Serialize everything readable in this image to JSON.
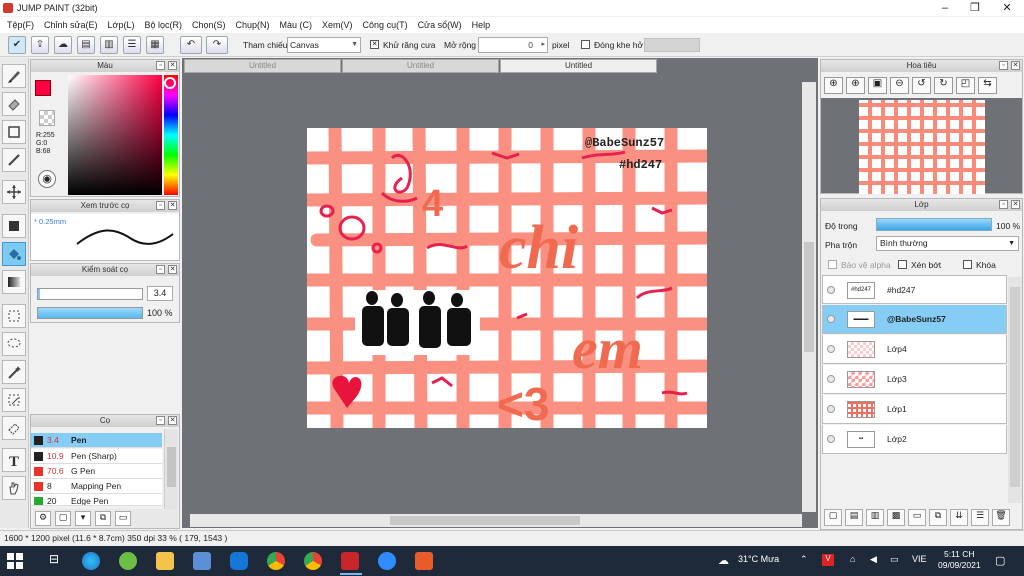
{
  "window": {
    "title": "JUMP PAINT (32bit)"
  },
  "menu": [
    "Tệp(F)",
    "Chỉnh sửa(E)",
    "Lớp(L)",
    "Bộ lọc(R)",
    "Chọn(S)",
    "Chụp(N)",
    "Màu (C)",
    "Xem(V)",
    "Công cụ(T)",
    "Cửa sổ(W)",
    "Help"
  ],
  "toolbar": {
    "ref_label": "Tham chiếu",
    "ref_value": "Canvas",
    "antialias_label": "Khử răng cưa",
    "expand_label": "Mở rộng",
    "expand_value": "0",
    "expand_unit": "pixel",
    "close_gap_label": "Đóng khe hở"
  },
  "doc_tabs": [
    "Untitled",
    "Untitled",
    "Untitled"
  ],
  "color_panel": {
    "title": "Màu",
    "r": "R:255",
    "g": "G:0",
    "b": "B:68",
    "primary": "#ff0044",
    "secondary": "#ff6a3d"
  },
  "brush_preview": {
    "title": "Xem trước cọ",
    "size": "* 0.25mm"
  },
  "brush_control": {
    "title": "Kiểm soát cọ",
    "size": "3.4",
    "opacity": "100 %"
  },
  "brush_list": {
    "title": "Cọ",
    "items": [
      {
        "size": "3.4",
        "name": "Pen",
        "color": "#222222",
        "selected": true
      },
      {
        "size": "10.9",
        "name": "Pen (Sharp)",
        "color": "#222222",
        "selected": false
      },
      {
        "size": "70.6",
        "name": "G Pen",
        "color": "#e8332a",
        "selected": false
      },
      {
        "size": "8",
        "name": "Mapping Pen",
        "color": "#e8332a",
        "selected": false
      },
      {
        "size": "20",
        "name": "Edge Pen",
        "color": "#22aa33",
        "selected": false
      }
    ]
  },
  "navigator": {
    "title": "Hoa tiêu"
  },
  "layers": {
    "title": "Lớp",
    "opacity_label": "Độ trong",
    "opacity_value": "100 %",
    "blend_label": "Pha trộn",
    "blend_value": "Bình thường",
    "protect_alpha": "Bảo vệ alpha",
    "clipping": "Xén bớt",
    "lock": "Khóa",
    "items": [
      {
        "name": "#hd247",
        "selected": false
      },
      {
        "name": "@BabeSunz57",
        "selected": true
      },
      {
        "name": "Lớp4",
        "selected": false
      },
      {
        "name": "Lớp3",
        "selected": false
      },
      {
        "name": "Lớp1",
        "selected": false
      },
      {
        "name": "Lớp2",
        "selected": false
      }
    ]
  },
  "artwork": {
    "tag1": "@BabeSunz57",
    "tag2": "#hd247",
    "word1": "chi",
    "word2": "em",
    "heart_text": "<3",
    "num4": "4"
  },
  "status": {
    "text": "1600 * 1200 pixel  (11.6 * 8.7cm)  350 dpi  33 %  ( 179, 1543 )"
  },
  "taskbar": {
    "weather": "31°C  Mưa",
    "lang": "VIE",
    "time": "5:11 CH",
    "date": "09/09/2021"
  }
}
